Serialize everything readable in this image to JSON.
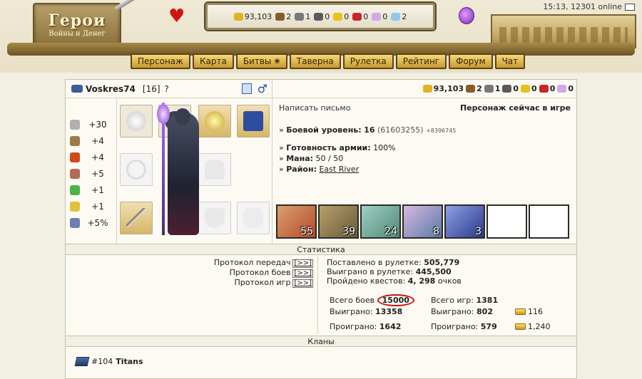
{
  "header": {
    "logo_title": "Герои",
    "logo_subtitle": "Войны и Денег",
    "clock": "15:13, 12301 online",
    "resources": [
      {
        "icon": "gold-icon",
        "value": "93,103",
        "color": "#e0b324"
      },
      {
        "icon": "wood-icon",
        "value": "2",
        "color": "#8a5a2a"
      },
      {
        "icon": "ore-icon",
        "value": "1",
        "color": "#7a7a7a"
      },
      {
        "icon": "mercury-icon",
        "value": "0",
        "color": "#5a5a5a"
      },
      {
        "icon": "sulfur-icon",
        "value": "0",
        "color": "#e6c21a"
      },
      {
        "icon": "crystal-icon",
        "value": "0",
        "color": "#c8262a"
      },
      {
        "icon": "gems-icon",
        "value": "0",
        "color": "#d5a6e8"
      },
      {
        "icon": "diamond-icon",
        "value": "2",
        "color": "#8ec8f0"
      }
    ],
    "nav": [
      "Персонаж",
      "Карта",
      "Битвы",
      "Таверна",
      "Рулетка",
      "Рейтинг",
      "Форум",
      "Чат"
    ]
  },
  "player": {
    "nick": "Voskres74",
    "level": "[16]",
    "help": "?",
    "gender_symbol": "♂"
  },
  "top_resources": [
    {
      "icon": "gold-icon",
      "value": "93,103",
      "color": "#e0b324"
    },
    {
      "icon": "wood-icon",
      "value": "2",
      "color": "#8a5a2a"
    },
    {
      "icon": "ore-icon",
      "value": "1",
      "color": "#7a7a7a"
    },
    {
      "icon": "mercury-icon",
      "value": "0",
      "color": "#5a5a5a"
    },
    {
      "icon": "sulfur-icon",
      "value": "0",
      "color": "#e6c21a"
    },
    {
      "icon": "crystal-icon",
      "value": "0",
      "color": "#c8262a"
    },
    {
      "icon": "gems-icon",
      "value": "0",
      "color": "#d5a6e8"
    }
  ],
  "bonuses": [
    {
      "icon": "attack-icon",
      "value": "+30",
      "color": "#b0b0b0"
    },
    {
      "icon": "defense-icon",
      "value": "+4",
      "color": "#9b7b45"
    },
    {
      "icon": "spellpower-icon",
      "value": "+4",
      "color": "#d04a1a"
    },
    {
      "icon": "knowledge-icon",
      "value": "+5",
      "color": "#b46a5a"
    },
    {
      "icon": "luck-icon",
      "value": "+1",
      "color": "#4fb04a"
    },
    {
      "icon": "morale-icon",
      "value": "+1",
      "color": "#e1c23a"
    },
    {
      "icon": "initiative-icon",
      "value": "+5%",
      "color": "#6c7fb4"
    }
  ],
  "info": {
    "write_letter": "Написать письмо",
    "status": "Персонаж сейчас в игре",
    "combat_label": "Боевой уровень:",
    "combat_value": "16",
    "combat_exp": "(61603255)",
    "combat_extra": "+8396745",
    "army_label": "Готовность армии:",
    "army_value": "100%",
    "mana_label": "Мана:",
    "mana_value": "50 / 50",
    "district_label": "Район:",
    "district_value": "East River"
  },
  "army": [
    {
      "count": "55",
      "color": "#b84a2a"
    },
    {
      "count": "39",
      "color": "#6a5a3a"
    },
    {
      "count": "24",
      "color": "#4f8a7a"
    },
    {
      "count": "8",
      "color": "#5a7aa8"
    },
    {
      "count": "3",
      "color": "#2a3a8a"
    },
    {
      "count": "",
      "color": "#ffffff"
    },
    {
      "count": "",
      "color": "#ffffff"
    }
  ],
  "stats": {
    "title": "Статистика",
    "protocols": [
      {
        "label": "Протокол передач",
        "link": "[>>]"
      },
      {
        "label": "Протокол боев",
        "link": "[>>]"
      },
      {
        "label": "Протокол игр",
        "link": "[>>]"
      }
    ],
    "roulette_bet_label": "Поставлено в рулетке:",
    "roulette_bet_value": "505,779",
    "roulette_won_label": "Выиграно в рулетке:",
    "roulette_won_value": "445,500",
    "quests_label": "Пройдено квестов:",
    "quests_value": "4, 298",
    "quests_unit": "очков",
    "total_battles_label": "Всего боев",
    "total_battles_value": "15000",
    "total_games_label": "Всего игр:",
    "total_games_value": "1381",
    "won_label": "Выиграно:",
    "won_battles_value": "13358",
    "won_games_value": "802",
    "won_gold_value": "116",
    "lost_label": "Проиграно:",
    "lost_battles_value": "1642",
    "lost_games_value": "579",
    "lost_gold_value": "1,240"
  },
  "clans": {
    "title": "Кланы",
    "items": [
      {
        "id": "#104",
        "name": "Titans"
      }
    ]
  }
}
